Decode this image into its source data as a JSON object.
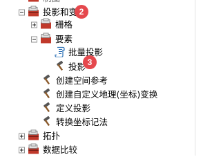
{
  "tree": {
    "top_cut_label": "制图",
    "items": [
      {
        "label": "投影和变"
      },
      {
        "label": "栅格"
      },
      {
        "label": "要素"
      },
      {
        "label": "批量投影"
      },
      {
        "label": "投影"
      },
      {
        "label": "创建空间参考"
      },
      {
        "label": "创建自定义地理(坐标)变换"
      },
      {
        "label": "定义投影"
      },
      {
        "label": "转换坐标记法"
      },
      {
        "label": "拓扑"
      },
      {
        "label": "数据比较"
      }
    ]
  },
  "badges": [
    "2",
    "3"
  ]
}
